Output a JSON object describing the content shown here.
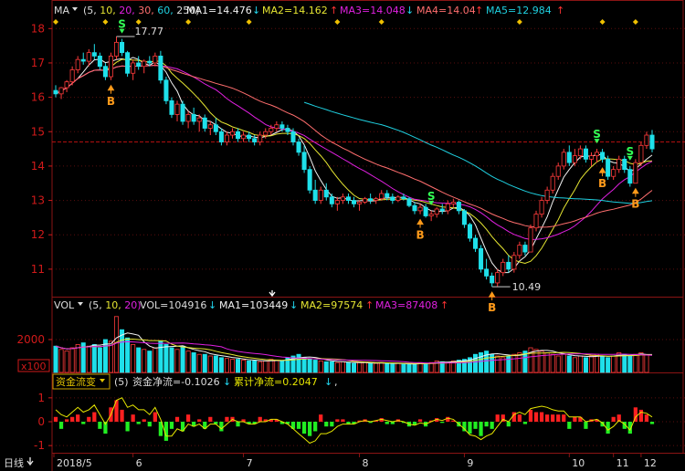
{
  "colors": {
    "bg": "#000000",
    "frame": "#8a1414",
    "grid": "#5a0e0e",
    "ref_line": "#b01010",
    "axis_label": "#d11a1a",
    "up": "#ff3b3b",
    "down": "#1fe0ea",
    "ma1": "#f2f2f2",
    "ma2": "#e6e632",
    "ma3": "#e020e0",
    "ma4": "#ff6e6e",
    "ma5": "#1fd0e0",
    "cash_line": "#e6e600",
    "diamond": "#f0c000",
    "buy": "#ff9a1a",
    "sell": "#33ff55",
    "arrow_up_red": "#ff3333",
    "arrow_down_cyan": "#22d6ee"
  },
  "price_panel": {
    "indicator": "MA",
    "params_prefix": "(5,",
    "param_10": "10,",
    "param_20": "20,",
    "param_30": "30,",
    "param_60": "60,",
    "param_250": "250)",
    "ma1_label": "MA1=14.476",
    "ma1_dir": "↓",
    "ma2_label": "MA2=14.162",
    "ma2_dir": "↑",
    "ma3_label": "MA3=14.048",
    "ma3_dir": "↓",
    "ma4_label": "MA4=14.04",
    "ma4_dir": "↑",
    "ma5_label": "MA5=12.984",
    "ma5_dir": "↑",
    "y_ticks": [
      "18",
      "17",
      "16",
      "15",
      "14",
      "13",
      "12",
      "11"
    ],
    "y_tick_values": [
      18,
      17,
      16,
      15,
      14,
      13,
      12,
      11
    ],
    "high_label": "17.77",
    "low_label": "10.49",
    "signal_buy": "B",
    "signal_sell": "S"
  },
  "volume_panel": {
    "indicator": "VOL",
    "params": "(5,",
    "param_10": "10,",
    "param_20": "20)",
    "vol_label": "VOL=104916",
    "vol_dir": "↓",
    "ma1_label": "MA1=103449",
    "ma1_dir": "↓",
    "ma2_label": "MA2=97574",
    "ma2_dir": "↑",
    "ma3_label": "MA3=87408",
    "ma3_dir": "↑",
    "y_tick": "2000",
    "unit": "x100"
  },
  "flow_panel": {
    "indicator": "资金流变",
    "param": "(5)",
    "net_label": "资金净流=-0.1026",
    "net_dir": "↓",
    "cum_label": "累计净流=0.2047",
    "cum_dir": "↓",
    "suffix": ",",
    "y_ticks": [
      "1",
      "0",
      "-1"
    ]
  },
  "x_axis": {
    "period": "日线",
    "period_icon": "down-arrow",
    "labels": [
      "2018/5",
      "6",
      "7",
      "8",
      "9",
      "10",
      "11",
      "12"
    ]
  },
  "price_data": {
    "ohlc": [
      [
        16.2,
        16.35,
        16.0,
        16.1
      ],
      [
        16.1,
        16.3,
        15.95,
        16.28
      ],
      [
        16.28,
        16.5,
        16.15,
        16.45
      ],
      [
        16.45,
        16.9,
        16.35,
        16.8
      ],
      [
        16.8,
        17.2,
        16.7,
        17.1
      ],
      [
        17.1,
        17.3,
        16.95,
        17.05
      ],
      [
        17.05,
        17.4,
        16.9,
        17.3
      ],
      [
        17.3,
        17.55,
        17.1,
        17.2
      ],
      [
        17.2,
        17.3,
        16.8,
        16.9
      ],
      [
        16.9,
        17.0,
        16.5,
        16.6
      ],
      [
        16.6,
        17.3,
        16.5,
        17.2
      ],
      [
        17.2,
        17.77,
        17.1,
        17.6
      ],
      [
        17.6,
        17.7,
        17.2,
        17.3
      ],
      [
        17.3,
        17.35,
        16.6,
        16.7
      ],
      [
        16.7,
        17.1,
        16.5,
        17.0
      ],
      [
        17.0,
        17.2,
        16.8,
        16.9
      ],
      [
        16.9,
        17.1,
        16.7,
        17.05
      ],
      [
        17.05,
        17.2,
        16.9,
        17.0
      ],
      [
        17.0,
        17.3,
        16.9,
        17.2
      ],
      [
        17.2,
        17.35,
        16.4,
        16.5
      ],
      [
        16.5,
        16.6,
        15.8,
        15.9
      ],
      [
        15.9,
        16.0,
        15.4,
        15.5
      ],
      [
        15.5,
        15.9,
        15.3,
        15.8
      ],
      [
        15.8,
        15.9,
        15.2,
        15.3
      ],
      [
        15.3,
        15.6,
        15.1,
        15.5
      ],
      [
        15.5,
        15.7,
        15.2,
        15.3
      ],
      [
        15.3,
        15.5,
        15.0,
        15.4
      ],
      [
        15.4,
        15.5,
        15.0,
        15.1
      ],
      [
        15.1,
        15.3,
        14.9,
        15.2
      ],
      [
        15.2,
        15.4,
        14.9,
        15.0
      ],
      [
        15.0,
        15.1,
        14.6,
        14.7
      ],
      [
        14.7,
        15.0,
        14.6,
        14.9
      ],
      [
        14.9,
        15.1,
        14.8,
        15.0
      ],
      [
        15.0,
        15.1,
        14.7,
        14.8
      ],
      [
        14.8,
        15.0,
        14.7,
        14.9
      ],
      [
        14.9,
        15.0,
        14.7,
        14.8
      ],
      [
        14.8,
        14.9,
        14.6,
        14.7
      ],
      [
        14.7,
        15.0,
        14.6,
        14.9
      ],
      [
        14.9,
        15.1,
        14.8,
        15.0
      ],
      [
        15.0,
        15.2,
        14.9,
        15.1
      ],
      [
        15.1,
        15.3,
        15.0,
        15.2
      ],
      [
        15.2,
        15.3,
        15.0,
        15.1
      ],
      [
        15.1,
        15.2,
        14.9,
        15.0
      ],
      [
        15.0,
        15.1,
        14.6,
        14.7
      ],
      [
        14.7,
        14.8,
        14.3,
        14.4
      ],
      [
        14.4,
        14.6,
        13.8,
        13.9
      ],
      [
        13.9,
        14.0,
        13.2,
        13.3
      ],
      [
        13.3,
        13.6,
        12.9,
        13.0
      ],
      [
        13.0,
        13.4,
        12.9,
        13.3
      ],
      [
        13.3,
        13.5,
        13.0,
        13.1
      ],
      [
        13.1,
        13.2,
        12.8,
        12.9
      ],
      [
        12.9,
        13.1,
        12.7,
        13.0
      ],
      [
        13.0,
        13.2,
        12.9,
        13.1
      ],
      [
        13.1,
        13.2,
        12.9,
        13.0
      ],
      [
        13.0,
        13.1,
        12.8,
        12.9
      ],
      [
        12.9,
        13.0,
        12.7,
        12.95
      ],
      [
        12.95,
        13.1,
        12.9,
        13.05
      ],
      [
        13.05,
        13.2,
        12.9,
        13.0
      ],
      [
        13.0,
        13.1,
        12.9,
        13.05
      ],
      [
        13.05,
        13.3,
        13.0,
        13.2
      ],
      [
        13.2,
        13.3,
        13.0,
        13.1
      ],
      [
        13.1,
        13.2,
        12.9,
        13.0
      ],
      [
        13.0,
        13.15,
        12.95,
        13.1
      ],
      [
        13.1,
        13.2,
        13.0,
        13.05
      ],
      [
        13.05,
        13.1,
        12.8,
        12.85
      ],
      [
        12.85,
        12.95,
        12.6,
        12.7
      ],
      [
        12.7,
        12.9,
        12.6,
        12.8
      ],
      [
        12.8,
        12.9,
        12.5,
        12.55
      ],
      [
        12.55,
        12.7,
        12.4,
        12.6
      ],
      [
        12.6,
        12.8,
        12.5,
        12.75
      ],
      [
        12.75,
        12.9,
        12.6,
        12.7
      ],
      [
        12.7,
        13.0,
        12.6,
        12.9
      ],
      [
        12.9,
        13.05,
        12.8,
        12.95
      ],
      [
        12.95,
        13.0,
        12.6,
        12.7
      ],
      [
        12.7,
        12.75,
        12.2,
        12.3
      ],
      [
        12.3,
        12.35,
        11.8,
        11.9
      ],
      [
        11.9,
        12.0,
        11.5,
        11.6
      ],
      [
        11.6,
        11.7,
        10.9,
        11.0
      ],
      [
        11.0,
        11.3,
        10.7,
        10.8
      ],
      [
        10.8,
        10.9,
        10.49,
        10.6
      ],
      [
        10.6,
        11.0,
        10.5,
        10.9
      ],
      [
        10.9,
        11.3,
        10.8,
        11.2
      ],
      [
        11.2,
        11.4,
        10.9,
        11.0
      ],
      [
        11.0,
        11.5,
        10.9,
        11.4
      ],
      [
        11.4,
        11.8,
        11.3,
        11.7
      ],
      [
        11.7,
        11.8,
        11.4,
        11.5
      ],
      [
        11.5,
        12.3,
        11.5,
        12.2
      ],
      [
        12.2,
        12.7,
        12.1,
        12.6
      ],
      [
        12.6,
        13.1,
        12.5,
        13.0
      ],
      [
        13.0,
        13.4,
        12.9,
        13.3
      ],
      [
        13.3,
        13.8,
        13.2,
        13.7
      ],
      [
        13.7,
        14.1,
        13.6,
        14.0
      ],
      [
        14.0,
        14.5,
        13.9,
        14.4
      ],
      [
        14.4,
        14.6,
        14.0,
        14.1
      ],
      [
        14.1,
        14.5,
        14.0,
        14.3
      ],
      [
        14.3,
        14.6,
        14.2,
        14.5
      ],
      [
        14.5,
        14.6,
        14.1,
        14.2
      ],
      [
        14.2,
        14.4,
        14.0,
        14.3
      ],
      [
        14.3,
        14.5,
        14.1,
        14.4
      ],
      [
        14.4,
        14.5,
        14.1,
        14.2
      ],
      [
        14.2,
        14.3,
        13.6,
        13.7
      ],
      [
        13.7,
        14.0,
        13.6,
        13.9
      ],
      [
        13.9,
        14.3,
        13.8,
        14.2
      ],
      [
        14.2,
        14.3,
        13.8,
        13.9
      ],
      [
        13.9,
        14.0,
        13.4,
        13.5
      ],
      [
        13.5,
        14.2,
        13.5,
        14.1
      ],
      [
        14.1,
        14.7,
        14.0,
        14.6
      ],
      [
        14.6,
        15.0,
        14.5,
        14.9
      ],
      [
        14.9,
        15.05,
        14.4,
        14.5
      ]
    ],
    "ma_periods": [
      5,
      10,
      20,
      30,
      60
    ]
  },
  "volume_data": {
    "values": [
      1600,
      1400,
      1300,
      1500,
      1700,
      1800,
      1600,
      1700,
      1500,
      2000,
      1900,
      3400,
      2600,
      2100,
      1700,
      1500,
      1400,
      1300,
      1500,
      1900,
      1700,
      1500,
      1400,
      1600,
      1300,
      1200,
      1100,
      1100,
      1000,
      1000,
      900,
      850,
      800,
      800,
      750,
      700,
      700,
      650,
      700,
      800,
      750,
      700,
      900,
      1000,
      1100,
      900,
      800,
      750,
      700,
      650,
      650,
      600,
      650,
      600,
      550,
      600,
      600,
      550,
      550,
      600,
      550,
      500,
      550,
      500,
      500,
      520,
      600,
      550,
      600,
      700,
      650,
      600,
      700,
      750,
      800,
      900,
      1100,
      1200,
      1300,
      1100,
      1000,
      900,
      1000,
      1100,
      1200,
      1300,
      1500,
      1400,
      1300,
      1200,
      1100,
      1000,
      1100,
      1000,
      900,
      1000,
      900,
      1000,
      1100,
      1000,
      900,
      1000,
      1200,
      1100,
      1000,
      1100,
      1200,
      1050
    ],
    "max": 3500
  },
  "flow_data": {
    "bars": [
      0.2,
      -0.3,
      0.1,
      0.2,
      0.3,
      -0.1,
      0.2,
      0.4,
      -0.3,
      -0.5,
      0.6,
      0.9,
      0.5,
      -0.4,
      0.3,
      -0.1,
      0.1,
      -0.2,
      0.4,
      -0.6,
      -0.8,
      -0.3,
      0.2,
      -0.4,
      0.3,
      -0.2,
      0.1,
      -0.3,
      0.2,
      -0.1,
      -0.4,
      0.2,
      0.2,
      -0.2,
      0.1,
      -0.1,
      -0.1,
      0.2,
      0.1,
      0.1,
      0.1,
      -0.1,
      -0.1,
      -0.3,
      -0.3,
      -0.5,
      -0.6,
      -0.4,
      0.3,
      -0.2,
      -0.2,
      0.1,
      0.1,
      -0.1,
      -0.1,
      0.05,
      0.1,
      -0.05,
      0.05,
      0.15,
      -0.1,
      -0.1,
      0.1,
      -0.05,
      -0.2,
      -0.15,
      0.1,
      -0.2,
      0.05,
      0.15,
      -0.05,
      0.2,
      0.05,
      -0.2,
      -0.4,
      -0.5,
      -0.3,
      -0.6,
      -0.2,
      -0.3,
      0.3,
      0.3,
      -0.2,
      0.4,
      0.3,
      -0.1,
      0.5,
      0.4,
      0.4,
      0.3,
      0.3,
      0.3,
      0.3,
      -0.3,
      0.2,
      0.2,
      -0.3,
      0.1,
      0.1,
      -0.2,
      -0.5,
      0.2,
      0.3,
      -0.3,
      -0.5,
      0.6,
      0.5,
      0.3,
      -0.1
    ],
    "line": [
      0.5,
      0.3,
      0.2,
      0.4,
      0.6,
      0.4,
      0.5,
      0.7,
      0.3,
      -0.1,
      0.3,
      0.9,
      1.0,
      0.6,
      0.7,
      0.5,
      0.5,
      0.3,
      0.6,
      0.1,
      -0.6,
      -0.6,
      -0.3,
      -0.4,
      -0.1,
      -0.2,
      -0.1,
      -0.3,
      -0.1,
      -0.1,
      -0.3,
      -0.1,
      0.1,
      0.0,
      0.0,
      -0.1,
      -0.1,
      0.0,
      0.0,
      0.1,
      0.1,
      0.0,
      -0.1,
      -0.3,
      -0.5,
      -0.7,
      -0.9,
      -0.8,
      -0.5,
      -0.5,
      -0.4,
      -0.2,
      -0.1,
      -0.1,
      -0.1,
      0.0,
      0.05,
      0.0,
      0.05,
      0.1,
      0.05,
      0.0,
      0.05,
      0.0,
      -0.1,
      -0.15,
      -0.05,
      -0.1,
      0.0,
      0.1,
      0.05,
      0.15,
      0.1,
      -0.1,
      -0.3,
      -0.55,
      -0.6,
      -0.75,
      -0.6,
      -0.5,
      -0.2,
      0.1,
      0.0,
      0.3,
      0.4,
      0.3,
      0.55,
      0.6,
      0.65,
      0.6,
      0.5,
      0.45,
      0.45,
      0.2,
      0.2,
      0.2,
      0.0,
      0.05,
      0.1,
      -0.05,
      -0.35,
      -0.2,
      0.05,
      -0.1,
      -0.35,
      0.2,
      0.4,
      0.35,
      0.2
    ],
    "range": [
      -1.3,
      1.3
    ]
  },
  "signals": [
    {
      "type": "B",
      "index": 10
    },
    {
      "type": "S",
      "index": 12
    },
    {
      "type": "B",
      "index": 66
    },
    {
      "type": "S",
      "index": 68
    },
    {
      "type": "B",
      "index": 79
    },
    {
      "type": "S",
      "index": 98
    },
    {
      "type": "B",
      "index": 99
    },
    {
      "type": "S",
      "index": 104
    },
    {
      "type": "B",
      "index": 105
    }
  ],
  "diamond_indices": [
    0,
    9,
    15,
    24,
    35,
    51,
    59,
    84,
    99,
    105
  ]
}
